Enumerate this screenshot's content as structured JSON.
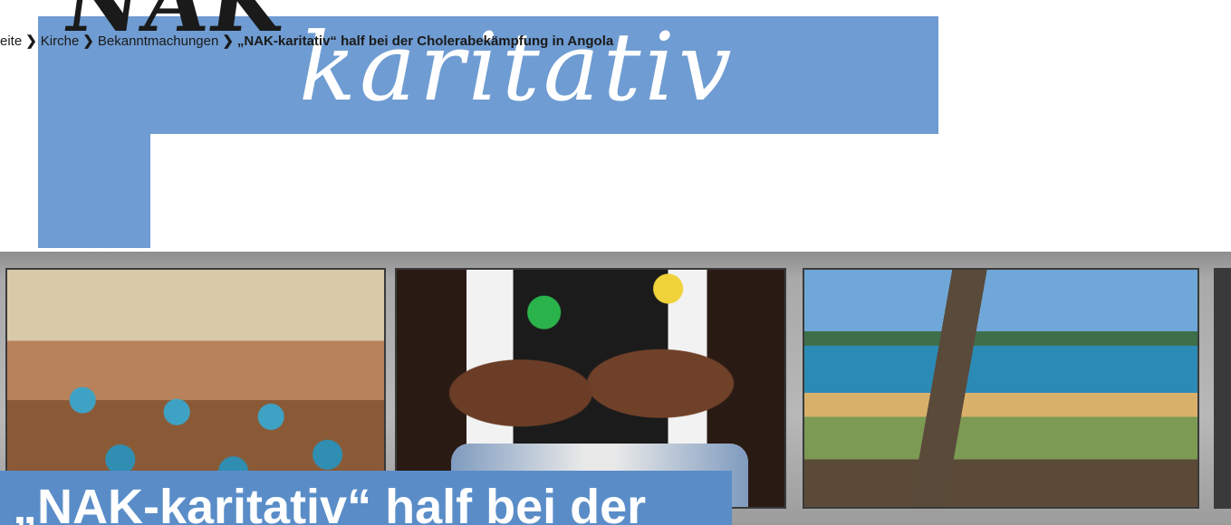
{
  "banner": {
    "logo_text": "NAK",
    "script_text": "karitativ"
  },
  "breadcrumb": {
    "items": [
      {
        "label": "eite"
      },
      {
        "label": "Kirche"
      },
      {
        "label": "Bekanntmachungen"
      },
      {
        "label": "„NAK-karitativ“ half bei der Cholerabekämpfung in Angola"
      }
    ],
    "separator": "❯"
  },
  "article": {
    "title": "„NAK-karitativ“ half bei der"
  },
  "colors": {
    "banner_blue": "#6f9cd2",
    "title_card_blue": "#5a8dc8"
  }
}
